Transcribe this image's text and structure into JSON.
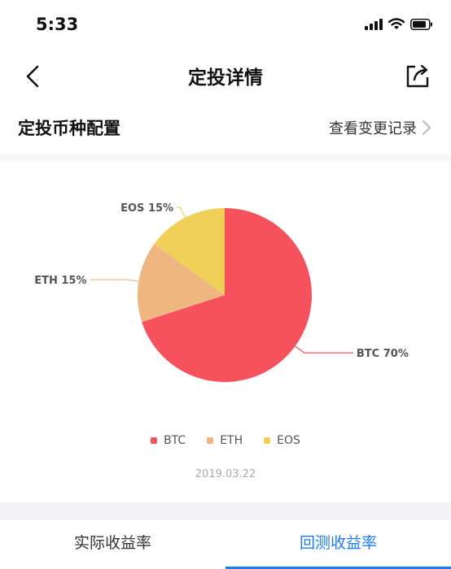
{
  "status_bar": {
    "time": "5:33"
  },
  "nav": {
    "title": "定投详情"
  },
  "section": {
    "title": "定投币种配置",
    "link_label": "查看变更记录"
  },
  "chart_data": {
    "type": "pie",
    "slices": [
      {
        "name": "BTC",
        "value": 70,
        "label": "BTC 70%",
        "color": "#f5525e"
      },
      {
        "name": "ETH",
        "value": 15,
        "label": "ETH 15%",
        "color": "#efb682"
      },
      {
        "name": "EOS",
        "value": 15,
        "label": "EOS 15%",
        "color": "#f1d05a"
      }
    ],
    "legend": [
      "BTC",
      "ETH",
      "EOS"
    ],
    "date": "2019.03.22"
  },
  "tabs": [
    {
      "label": "实际收益率",
      "active": false
    },
    {
      "label": "回测收益率",
      "active": true
    }
  ]
}
